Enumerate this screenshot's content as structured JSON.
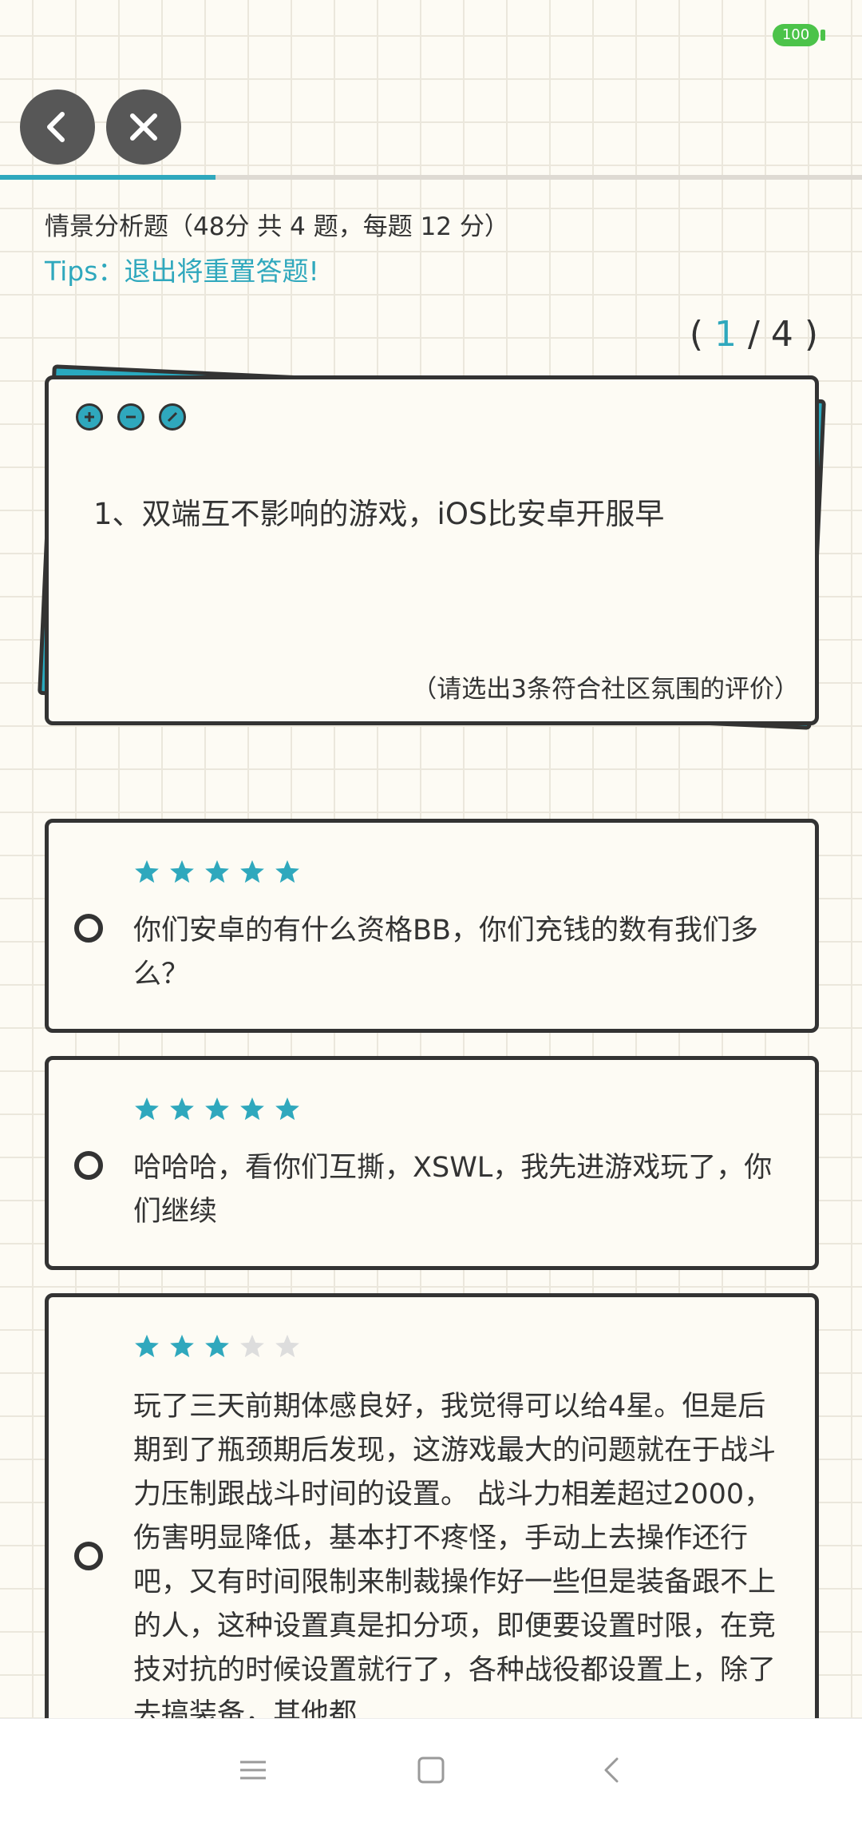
{
  "status_bar": {
    "battery": "100"
  },
  "header": {
    "progress_fraction": 0.25
  },
  "section": {
    "title": "情景分析题（48分 共 4 题，每题 12 分）",
    "tips": "Tips：退出将重置答题!"
  },
  "counter": {
    "open": "(",
    "current": "1",
    "separator": "/",
    "total": "4",
    "close": ")"
  },
  "question": {
    "text": "1、双端互不影响的游戏，iOS比安卓开服早",
    "hint": "（请选出3条符合社区氛围的评价）"
  },
  "options": [
    {
      "rating": 5,
      "text": "你们安卓的有什么资格BB，你们充钱的数有我们多么？"
    },
    {
      "rating": 5,
      "text": "哈哈哈，看你们互撕，XSWL，我先进游戏玩了，你们继续"
    },
    {
      "rating": 3,
      "text": "玩了三天前期体感良好，我觉得可以给4星。但是后期到了瓶颈期后发现，这游戏最大的问题就在于战斗力压制跟战斗时间的设置。 战斗力相差超过2000，伤害明显降低，基本打不疼怪，手动上去操作还行吧，又有时间限制来制裁操作好一些但是装备跟不上的人，这种设置真是扣分项，即便要设置时限，在竞技对抗的时候设置就行了，各种战役都设置上，除了去搞装备，其他都"
    }
  ],
  "colors": {
    "accent": "#2fa8bd",
    "dark": "#333333",
    "star_empty": "#dddddd",
    "paper": "#fdfbf4"
  }
}
